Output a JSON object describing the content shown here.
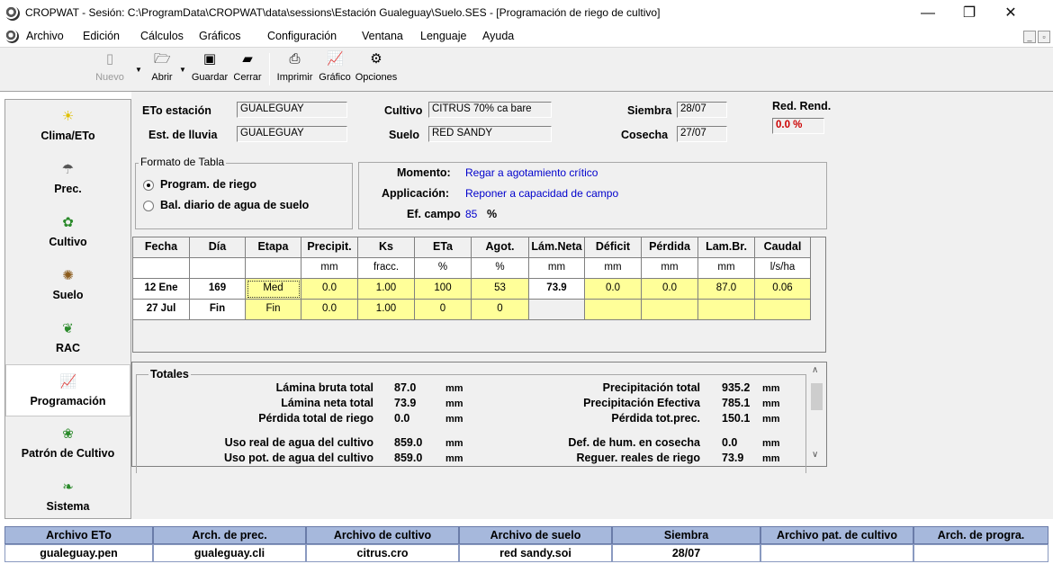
{
  "window": {
    "title": "CROPWAT - Sesión: C:\\ProgramData\\CROPWAT\\data\\sessions\\Estación Gualeguay\\Suelo.SES - [Programación de riego de cultivo]",
    "minimize": "—",
    "maximize": "❐",
    "close": "✕"
  },
  "menu": [
    "Archivo",
    "Edición",
    "Cálculos",
    "Gráficos",
    "Configuración",
    "Ventana",
    "Lenguaje",
    "Ayuda"
  ],
  "toolbar": {
    "nuevo": "Nuevo",
    "abrir": "Abrir",
    "guardar": "Guardar",
    "cerrar": "Cerrar",
    "imprimir": "Imprimir",
    "grafico": "Gráfico",
    "opciones": "Opciones"
  },
  "nav": [
    "Clima/ETo",
    "Prec.",
    "Cultivo",
    "Suelo",
    "RAC",
    "Programación",
    "Patrón de Cultivo",
    "Sistema"
  ],
  "info": {
    "eto_label": "ETo estación",
    "eto_value": "GUALEGUAY",
    "lluvia_label": "Est. de lluvia",
    "lluvia_value": "GUALEGUAY",
    "cultivo_label": "Cultivo",
    "cultivo_value": "CITRUS 70% ca bare",
    "suelo_label": "Suelo",
    "suelo_value": "RED SANDY",
    "siembra_label": "Siembra",
    "siembra_value": "28/07",
    "cosecha_label": "Cosecha",
    "cosecha_value": "27/07",
    "red_label": "Red. Rend.",
    "red_value": "0.0 %"
  },
  "formato": {
    "legend": "Formato de Tabla",
    "opt1": "Program. de riego",
    "opt2": "Bal. diario de agua de suelo",
    "selected": 1
  },
  "momento": {
    "momento_label": "Momento:",
    "momento_value": "Regar a agotamiento crítico",
    "aplic_label": "Applicación:",
    "aplic_value": "Reponer a capacidad de campo",
    "ef_label": "Ef. campo",
    "ef_value": "85",
    "ef_unit": "%"
  },
  "table": {
    "headers": [
      "Fecha",
      "Día",
      "Etapa",
      "Precipit.",
      "Ks",
      "ETa",
      "Agot.",
      "Lám.Neta",
      "Déficit",
      "Pérdida",
      "Lam.Br.",
      "Caudal"
    ],
    "units": [
      "",
      "",
      "",
      "mm",
      "fracc.",
      "%",
      "%",
      "mm",
      "mm",
      "mm",
      "mm",
      "l/s/ha"
    ],
    "rows": [
      [
        "12 Ene",
        "169",
        "Med",
        "0.0",
        "1.00",
        "100",
        "53",
        "73.9",
        "0.0",
        "0.0",
        "87.0",
        "0.06"
      ],
      [
        "27 Jul",
        "Fin",
        "Fin",
        "0.0",
        "1.00",
        "0",
        "0",
        "",
        "",
        "",
        "",
        ""
      ]
    ]
  },
  "totals": {
    "legend": "Totales",
    "left": [
      {
        "label": "Lámina bruta total",
        "value": "87.0",
        "unit": "mm"
      },
      {
        "label": "Lámina neta total",
        "value": "73.9",
        "unit": "mm"
      },
      {
        "label": "Pérdida total de riego",
        "value": "0.0",
        "unit": "mm"
      },
      {
        "label": "Uso real de agua del cultivo",
        "value": "859.0",
        "unit": "mm"
      },
      {
        "label": "Uso pot. de agua del cultivo",
        "value": "859.0",
        "unit": "mm"
      }
    ],
    "right": [
      {
        "label": "Precipitación total",
        "value": "935.2",
        "unit": "mm"
      },
      {
        "label": "Precipitación Efectiva",
        "value": "785.1",
        "unit": "mm"
      },
      {
        "label": "Pérdida tot.prec.",
        "value": "150.1",
        "unit": "mm"
      },
      {
        "label": "Def. de hum. en cosecha",
        "value": "0.0",
        "unit": "mm"
      },
      {
        "label": "Reguer. reales de riego",
        "value": "73.9",
        "unit": "mm"
      }
    ]
  },
  "status": {
    "headers": [
      "Archivo ETo",
      "Arch. de prec.",
      "Archivo de cultivo",
      "Archivo de suelo",
      "Siembra",
      "Archivo pat. de cultivo",
      "Arch. de progra."
    ],
    "values": [
      "gualeguay.pen",
      "gualeguay.cli",
      "citrus.cro",
      "red sandy.soi",
      "28/07",
      "",
      ""
    ]
  },
  "colors": {
    "status_header": "#a6b8dc",
    "table_yellow": "#ffff99",
    "link_blue": "#0000cc",
    "red_value": "#cc0000"
  }
}
